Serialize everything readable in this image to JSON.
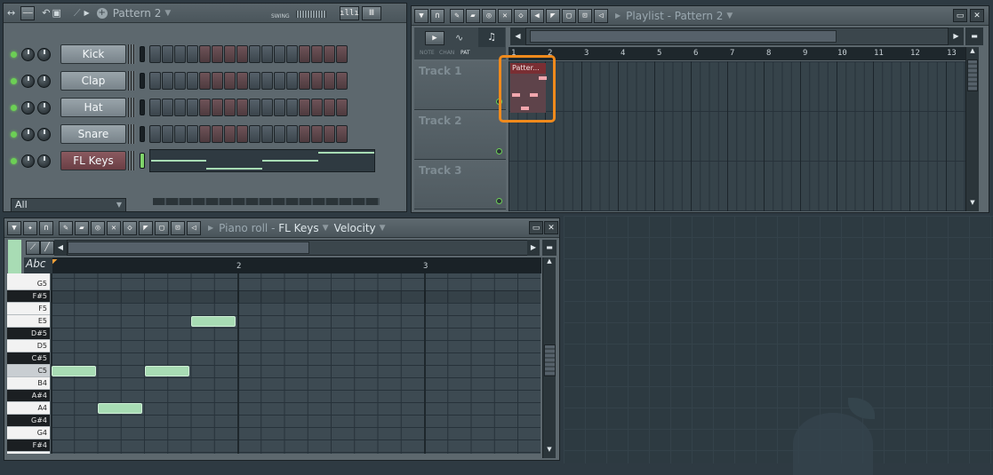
{
  "channel_rack": {
    "pattern_label": "Pattern 2",
    "swing_label": "SWING",
    "channels": [
      {
        "name": "Kick",
        "selected": false
      },
      {
        "name": "Clap",
        "selected": false
      },
      {
        "name": "Hat",
        "selected": false
      },
      {
        "name": "Snare",
        "selected": false
      },
      {
        "name": "FL Keys",
        "selected": true
      }
    ],
    "filter_value": "All"
  },
  "playlist": {
    "title_prefix": "Playlist - ",
    "title_pattern": "Pattern 2",
    "tabs": [
      "NOTE",
      "CHAN",
      "PAT"
    ],
    "ruler_numbers": [
      "1",
      "2",
      "3",
      "4",
      "5",
      "6",
      "7",
      "8",
      "9",
      "10",
      "11",
      "12",
      "13"
    ],
    "tracks": [
      "Track 1",
      "Track 2",
      "Track 3"
    ],
    "clip_label": "Patter..."
  },
  "piano_roll": {
    "title_prefix": "Piano roll - ",
    "title_instrument": "FL Keys",
    "velocity_label": "Velocity",
    "abc_label": "Abc",
    "ruler_numbers": [
      "2",
      "3"
    ],
    "keys": [
      "G5",
      "F#5",
      "F5",
      "E5",
      "D#5",
      "D5",
      "C#5",
      "C5",
      "B4",
      "A#4",
      "A4",
      "G#4",
      "G4",
      "F#4"
    ]
  },
  "colors": {
    "highlight": "#f08a1c",
    "note": "#a8dcb4",
    "clip": "#7a2e33"
  }
}
